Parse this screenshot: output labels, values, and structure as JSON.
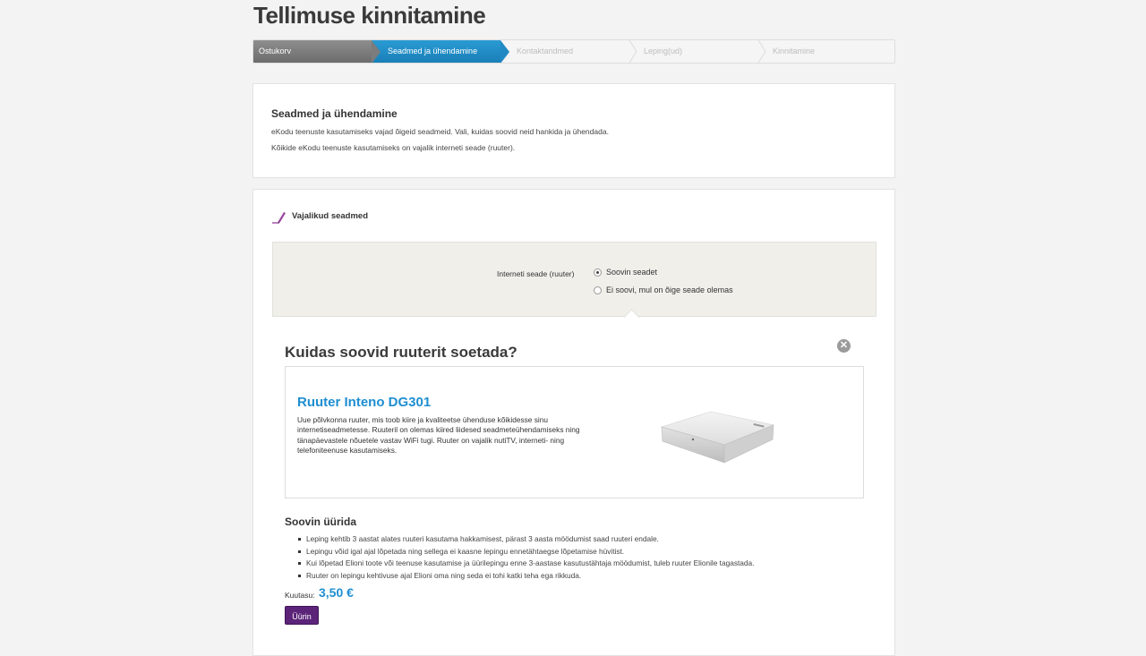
{
  "page": {
    "title": "Tellimuse kinnitamine"
  },
  "steps": [
    {
      "label": "Ostukorv",
      "state": "done"
    },
    {
      "label": "Seadmed ja ühendamine",
      "state": "active"
    },
    {
      "label": "Kontaktandmed",
      "state": "todo"
    },
    {
      "label": "Leping(ud)",
      "state": "todo"
    },
    {
      "label": "Kinnitamine",
      "state": "todo"
    }
  ],
  "intro": {
    "title": "Seadmed ja ühendamine",
    "line1": "eKodu teenuste kasutamiseks vajad õigeid seadmeid. Vali, kuidas soovid neid hankida ja ühendada.",
    "line2": "Kõikide eKodu teenuste kasutamiseks on vajalik interneti seade (ruuter)."
  },
  "devices": {
    "title": "Vajalikud seadmed",
    "icon": "pen-icon",
    "field_label": "Interneti seade (ruuter)",
    "options": [
      {
        "label": "Soovin seadet",
        "selected": true
      },
      {
        "label": "Ei soovi, mul on õige seade olemas",
        "selected": false
      }
    ]
  },
  "acquire": {
    "title": "Kuidas soovid ruuterit soetada?",
    "close_icon": "close-icon"
  },
  "product": {
    "name": "Ruuter Inteno DG301",
    "description": "Uue põlvkonna ruuter, mis toob kiire ja kvaliteetse ühenduse kõikidesse sinu internetiseadmetesse. Ruuteril on olemas kiired liidesed seadmeteühendamiseks ning tänapäevastele nõuetele vastav WiFi tugi. Ruuter on vajalik nutiTV, interneti- ning telefoniteenuse kasutamiseks.",
    "image": "router-image"
  },
  "rent": {
    "title": "Soovin üürida",
    "bullets": [
      "Leping kehtib 3 aastat alates ruuteri kasutama hakkamisest, pärast 3 aasta möödumist saad ruuteri endale.",
      "Lepingu võid igal ajal lõpetada ning sellega ei kaasne lepingu ennetähtaegse lõpetamise hüvitist.",
      "Kui lõpetad Elioni toote või teenuse kasutamise ja üürilepingu enne 3-aastase kasutustähtaja möödumist, tuleb ruuter Elionile tagastada.",
      "Ruuter on lepingu kehtivuse ajal Elioni oma ning seda ei tohi katki teha ega rikkuda."
    ],
    "price_label": "Kuutasu:",
    "price_value": "3,50 €",
    "button_label": "Üürin"
  },
  "colors": {
    "accent_blue": "#1e8ed1",
    "button_purple": "#5b2479",
    "step_done": "#7c7c7c"
  }
}
